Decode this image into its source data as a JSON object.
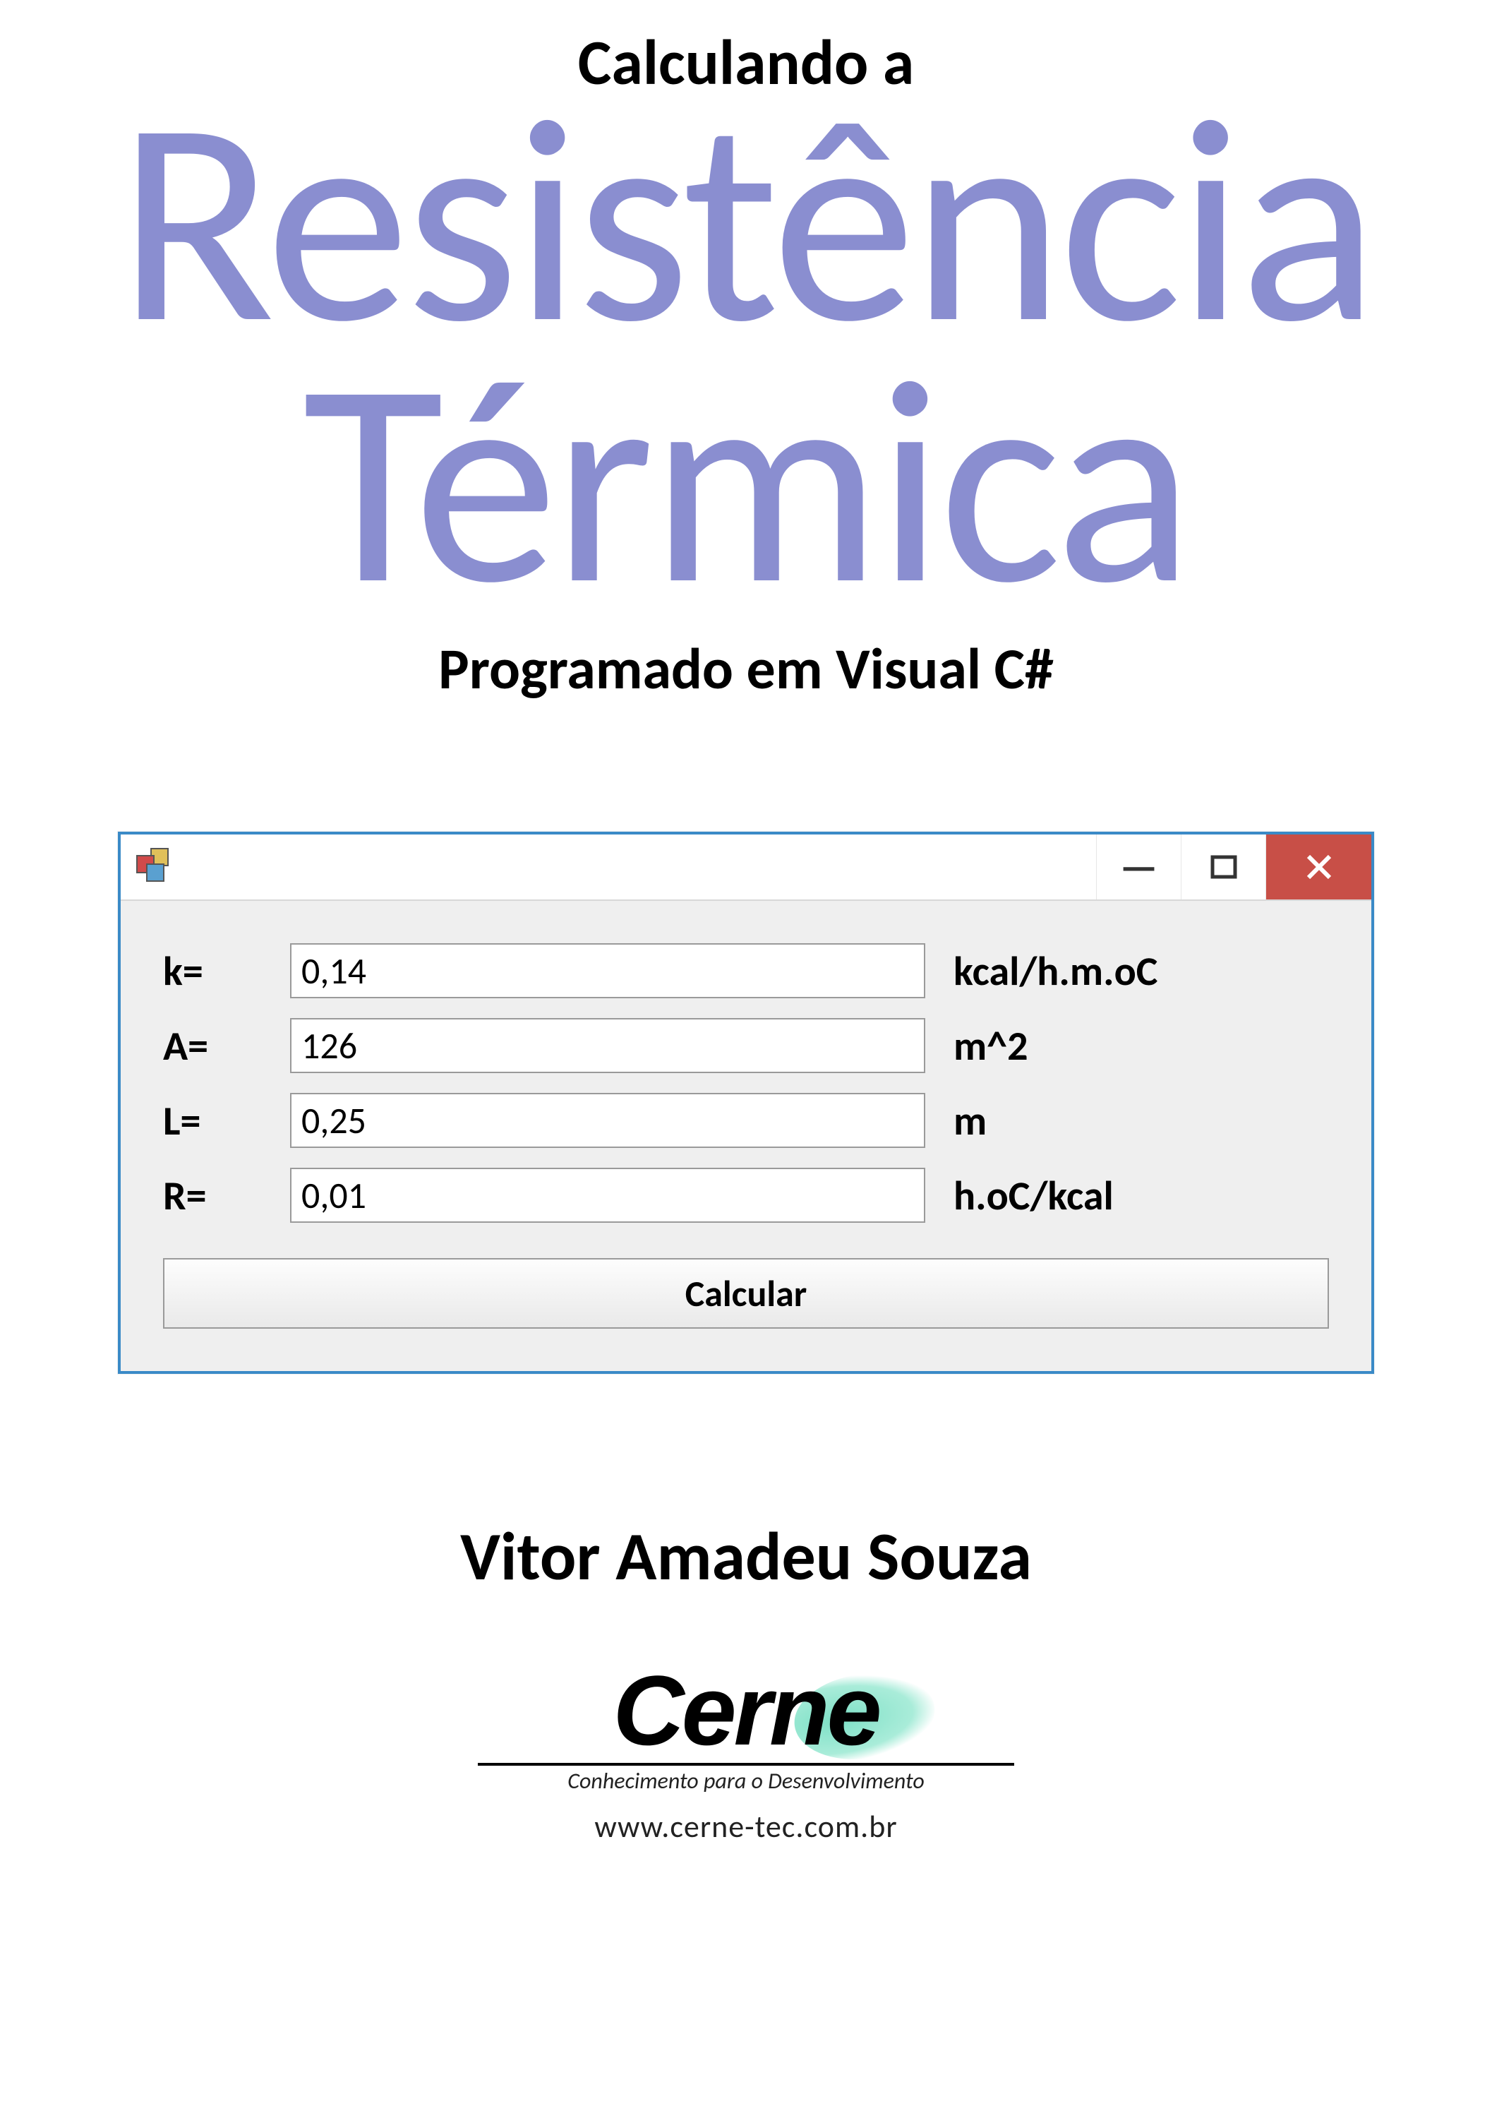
{
  "header": {
    "pretitle": "Calculando a",
    "title_line1": "Resistência",
    "title_line2": "Térmica",
    "subtitle": "Programado em Visual C#"
  },
  "window": {
    "controls": {
      "minimize_glyph": "—",
      "maximize_label": "Maximize",
      "close_label": "Close"
    },
    "rows": [
      {
        "label": "k=",
        "value": "0,14",
        "unit": "kcal/h.m.oC"
      },
      {
        "label": "A=",
        "value": "126",
        "unit": "m^2"
      },
      {
        "label": "L=",
        "value": "0,25",
        "unit": "m"
      },
      {
        "label": "R=",
        "value": "0,01",
        "unit": "h.oC/kcal"
      }
    ],
    "calculate_label": "Calcular"
  },
  "author": "Vitor Amadeu Souza",
  "logo": {
    "name": "Cerne",
    "tagline": "Conhecimento para o Desenvolvimento",
    "url": "www.cerne-tec.com.br"
  },
  "colors": {
    "title_lilac": "#8a8ed0",
    "window_border": "#3a8ac7",
    "close_red": "#c84f47",
    "logo_teal": "#7de0c6"
  }
}
